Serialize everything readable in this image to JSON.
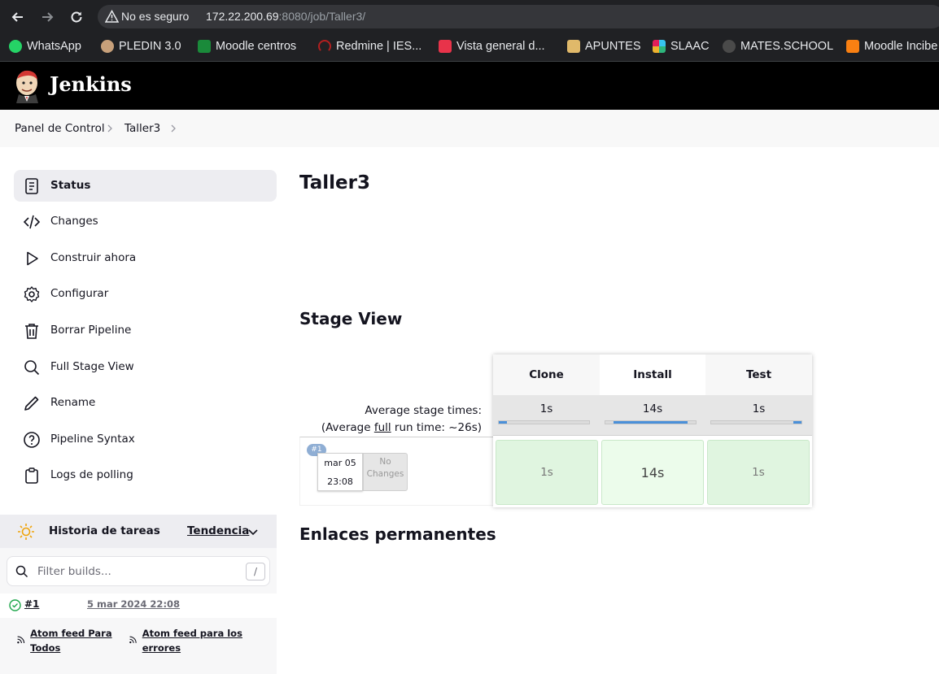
{
  "browser": {
    "security_label": "No es seguro",
    "url_host": "172.22.200.69",
    "url_rest": ":8080/job/Taller3/"
  },
  "bookmarks": [
    {
      "label": "WhatsApp",
      "icon": "whatsapp-icon",
      "color": "#25d366"
    },
    {
      "label": "PLEDIN 3.0",
      "icon": "pledin-icon",
      "color": "#c7a07a"
    },
    {
      "label": "Moodle centros",
      "icon": "moodle-centros-icon",
      "color": "#1a8a3a"
    },
    {
      "label": "Redmine | IES...",
      "icon": "redmine-icon",
      "color": "#b21f1f"
    },
    {
      "label": "Vista general d...",
      "icon": "vista-general-icon",
      "color": "#e8334a"
    },
    {
      "label": "APUNTES",
      "icon": "apuntes-icon",
      "color": "#e0b96a"
    },
    {
      "label": "SLAAC",
      "icon": "slack-icon",
      "color": "#e01e5a"
    },
    {
      "label": "MATES.SCHOOL",
      "icon": "mates-school-icon",
      "color": "#4a4a4a"
    },
    {
      "label": "Moodle Incibe",
      "icon": "moodle-incibe-icon",
      "color": "#f98012"
    }
  ],
  "header": {
    "title": "Jenkins"
  },
  "breadcrumbs": [
    "Panel de Control",
    "Taller3"
  ],
  "sidebar": {
    "items": [
      {
        "label": "Status",
        "icon": "status-icon"
      },
      {
        "label": "Changes",
        "icon": "code-icon"
      },
      {
        "label": "Construir ahora",
        "icon": "play-icon"
      },
      {
        "label": "Configurar",
        "icon": "gear-icon"
      },
      {
        "label": "Borrar Pipeline",
        "icon": "trash-icon"
      },
      {
        "label": "Full Stage View",
        "icon": "search-icon"
      },
      {
        "label": "Rename",
        "icon": "pencil-icon"
      },
      {
        "label": "Pipeline Syntax",
        "icon": "help-icon"
      },
      {
        "label": "Logs de polling",
        "icon": "clipboard-icon"
      }
    ]
  },
  "history": {
    "title": "Historia de tareas",
    "trend_label": "Tendencia",
    "filter_placeholder": "Filter builds...",
    "filter_shortcut": "/",
    "builds": [
      {
        "number": "#1",
        "date": "5 mar 2024 22:08"
      }
    ],
    "feeds": [
      "Atom feed Para Todos",
      "Atom feed para los errores"
    ]
  },
  "main": {
    "title": "Taller3",
    "stage_view_title": "Stage View",
    "permalinks_title": "Enlaces permanentes"
  },
  "stage_view": {
    "avg_label": "Average stage times:",
    "avg_run_prefix": "(Average ",
    "avg_run_link": "full",
    "avg_run_suffix": " run time: ~26s)",
    "stages": [
      {
        "name": "Clone",
        "avg": "1s",
        "bar_start": 0.0,
        "bar_end": 0.09
      },
      {
        "name": "Install",
        "avg": "14s",
        "bar_start": 0.09,
        "bar_end": 0.91
      },
      {
        "name": "Test",
        "avg": "1s",
        "bar_start": 0.91,
        "bar_end": 1.0
      }
    ],
    "runs": [
      {
        "badge": "#1",
        "date": "mar 05",
        "time": "23:08",
        "changes": "No Changes",
        "durations": [
          "1s",
          "14s",
          "1s"
        ]
      }
    ],
    "colors": {
      "success_cell": "#e0f5e0",
      "progress_bar": "#4a90d9"
    }
  }
}
